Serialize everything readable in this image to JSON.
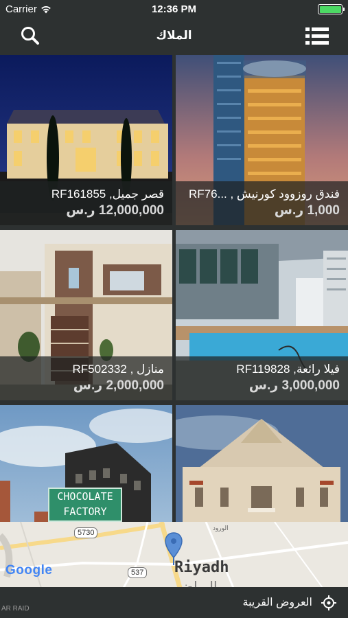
{
  "status_bar": {
    "carrier": "Carrier",
    "time": "12:36 PM",
    "battery_level": 1.0
  },
  "header": {
    "title": "الملاك"
  },
  "listings": [
    {
      "name": "قصر جميل, RF161855",
      "price": "12,000,000 ر.س"
    },
    {
      "name": "فندق روزوود كورنيش , ...RF76",
      "price": "1,000 ر.س"
    },
    {
      "name": "منازل , RF502332",
      "price": "2,000,000 ر.س"
    },
    {
      "name": "فيلا رائعة, RF119828",
      "price": "3,000,000 ر.س"
    },
    {
      "name": "",
      "price": ""
    },
    {
      "name": "",
      "price": ""
    }
  ],
  "building_sign": "CHOCOLATE\nFACTORY",
  "map": {
    "provider": "Google",
    "city_en": "Riyadh",
    "city_ar": "الرياض",
    "roads": [
      "5730",
      "537"
    ],
    "street": "الورود",
    "corner_label": "AR RAID"
  },
  "footer": {
    "nearby_label": "العروض القريبة"
  },
  "colors": {
    "bar": "#2d3131",
    "battery": "#4cd964",
    "pin": "#5b8fd6"
  }
}
